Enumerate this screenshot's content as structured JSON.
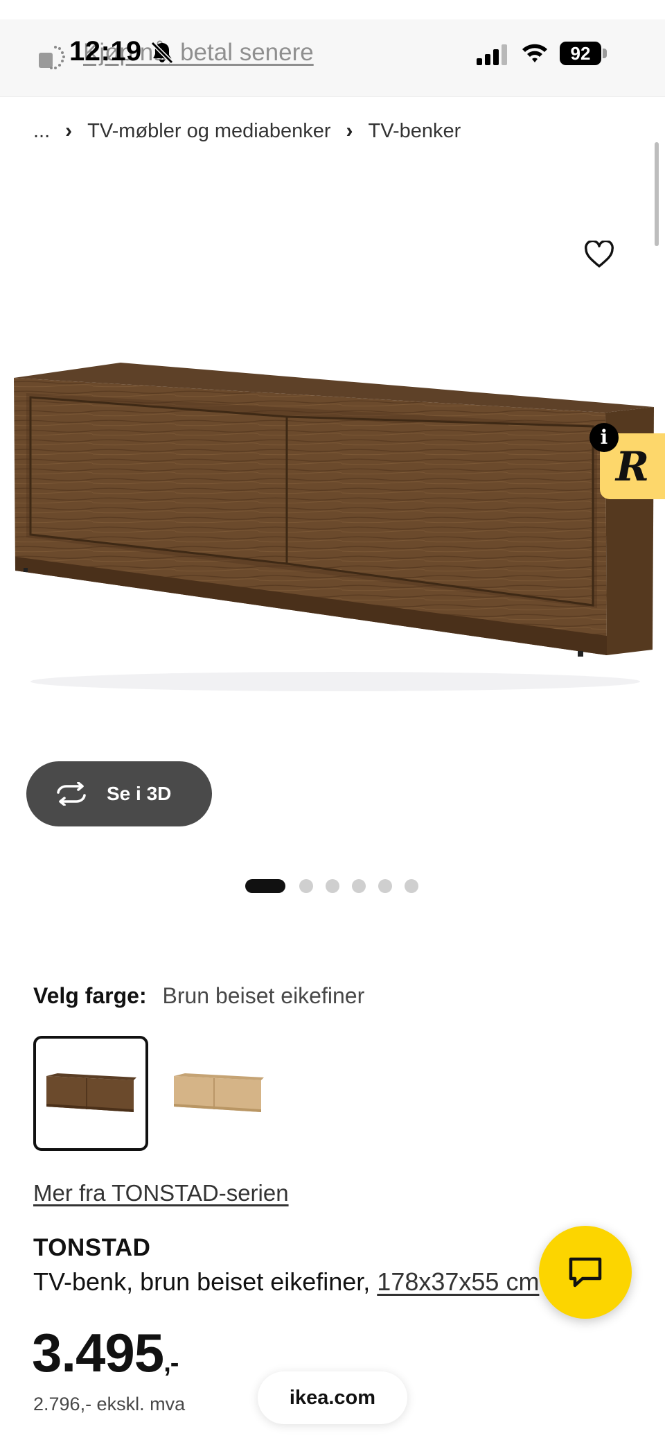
{
  "status_bar": {
    "time": "12:19",
    "battery": "92",
    "promo_text": "Kjøp nå, betal senere"
  },
  "breadcrumb": {
    "ellipsis": "...",
    "items": [
      "TV-møbler og mediabenker",
      "TV-benker"
    ]
  },
  "gallery": {
    "view_3d_label": "Se i 3D",
    "slide_count": 6,
    "active_slide": 1
  },
  "side_widget": {
    "badge": "i",
    "letter": "R"
  },
  "color": {
    "label": "Velg farge:",
    "selected_value": "Brun beiset eikefiner",
    "options": [
      "brown-stained-oak",
      "oak-veneer"
    ]
  },
  "series_link": "Mer fra TONSTAD-serien",
  "product": {
    "name": "TONSTAD",
    "description": "TV-benk, brun beiset eikefiner,",
    "dimensions": "178x37x55 cm",
    "price_main": "3.495",
    "price_suffix": ",-",
    "price_ex_vat": "2.796,- ekskl. mva"
  },
  "browser": {
    "url": "ikea.com"
  },
  "colors": {
    "accent_yellow": "#fcd500",
    "widget_yellow": "#fdd76b",
    "button_dark": "#4a4a4a",
    "wood_brown": "#6b4a2c",
    "wood_light": "#d5b487"
  }
}
